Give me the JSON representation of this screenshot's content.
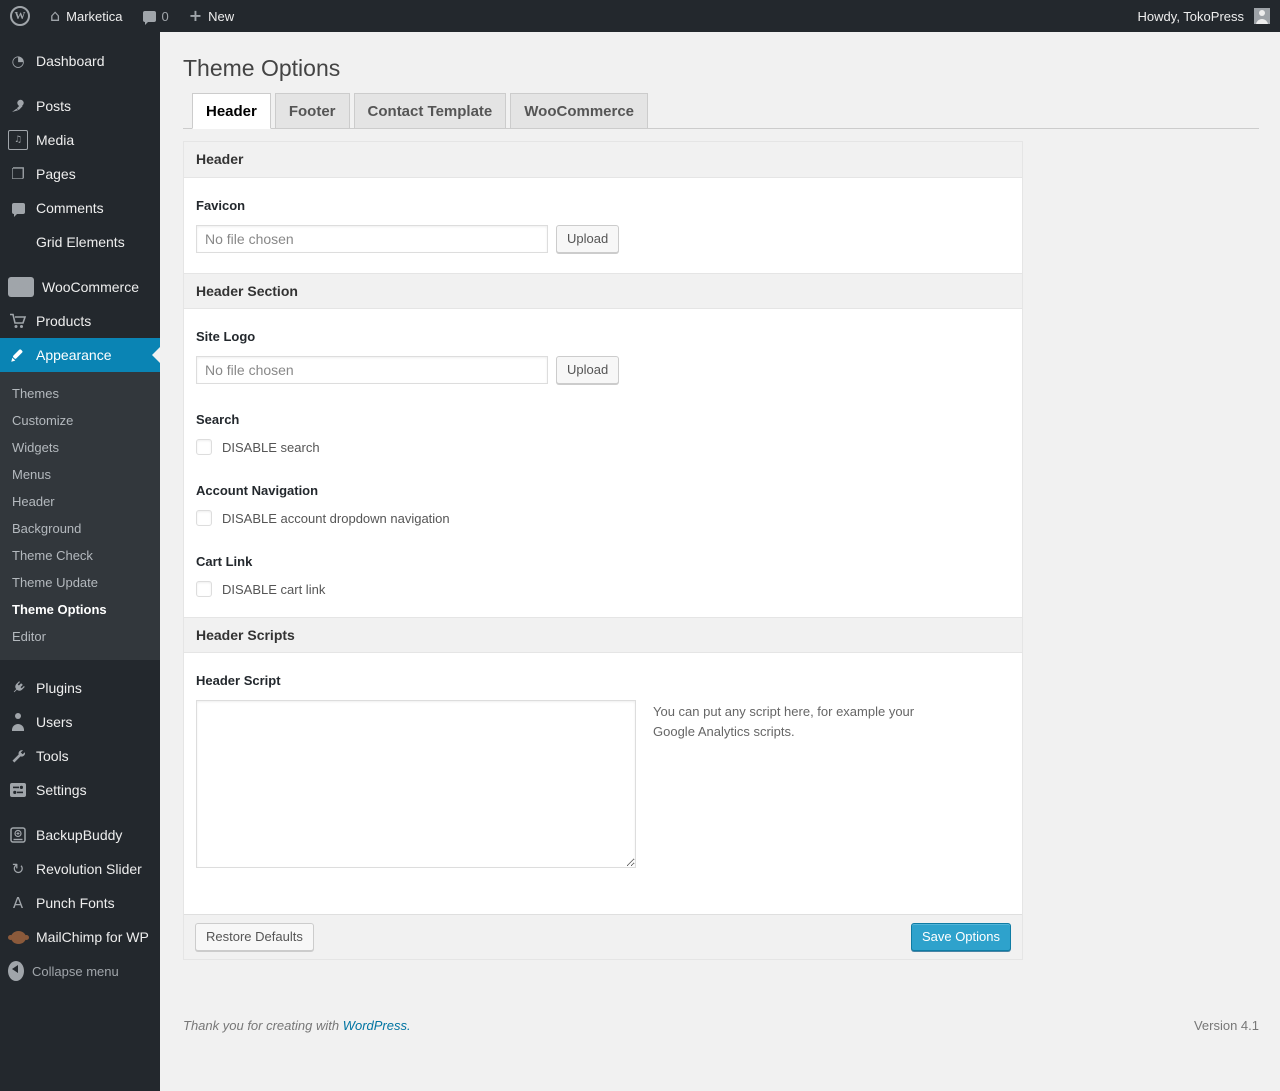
{
  "colors": {
    "menu_highlight": "#0a84b4",
    "button_primary": "#2ea2cc",
    "link": "#0074a2"
  },
  "icons": {
    "wp_logo": "W",
    "home": "⌂",
    "plus": "+",
    "dashboard": "◔",
    "media": "♫",
    "pages": "❐",
    "woo": "Woo",
    "revolution_slider": "↻",
    "punch_fonts": "A",
    "comments": "speech-bubble",
    "avatar": "person-silhouette"
  },
  "admin_bar": {
    "site_name": "Marketica",
    "comment_count": "0",
    "new_label": "New",
    "howdy": "Howdy, TokoPress"
  },
  "sidebar": {
    "items": [
      "Dashboard",
      "Posts",
      "Media",
      "Pages",
      "Comments",
      "Grid Elements",
      "WooCommerce",
      "Products",
      "Appearance",
      "Plugins",
      "Users",
      "Tools",
      "Settings",
      "BackupBuddy",
      "Revolution Slider",
      "Punch Fonts",
      "MailChimp for WP",
      "Collapse menu"
    ],
    "appearance_submenu": [
      "Themes",
      "Customize",
      "Widgets",
      "Menus",
      "Header",
      "Background",
      "Theme Check",
      "Theme Update",
      "Theme Options",
      "Editor"
    ],
    "current_item": "Appearance",
    "current_submenu_item": "Theme Options"
  },
  "page": {
    "title": "Theme Options",
    "tabs": [
      "Header",
      "Footer",
      "Contact Template",
      "WooCommerce"
    ],
    "active_tab": "Header"
  },
  "options": {
    "section1_title": "Header",
    "favicon_label": "Favicon",
    "favicon_value": "No file chosen",
    "upload_label": "Upload",
    "section2_title": "Header Section",
    "site_logo_label": "Site Logo",
    "site_logo_value": "No file chosen",
    "search_label": "Search",
    "search_checkbox": "DISABLE search",
    "account_nav_label": "Account Navigation",
    "account_nav_checkbox": "DISABLE account dropdown navigation",
    "cart_link_label": "Cart Link",
    "cart_link_checkbox": "DISABLE cart link",
    "section3_title": "Header Scripts",
    "header_script_label": "Header Script",
    "header_script_value": "",
    "header_script_help": "You can put any script here, for example your Google Analytics scripts.",
    "restore_label": "Restore Defaults",
    "save_label": "Save Options"
  },
  "footer": {
    "thanks_prefix": "Thank you for creating with",
    "wordpress_link": "WordPress.",
    "version": "Version 4.1"
  }
}
